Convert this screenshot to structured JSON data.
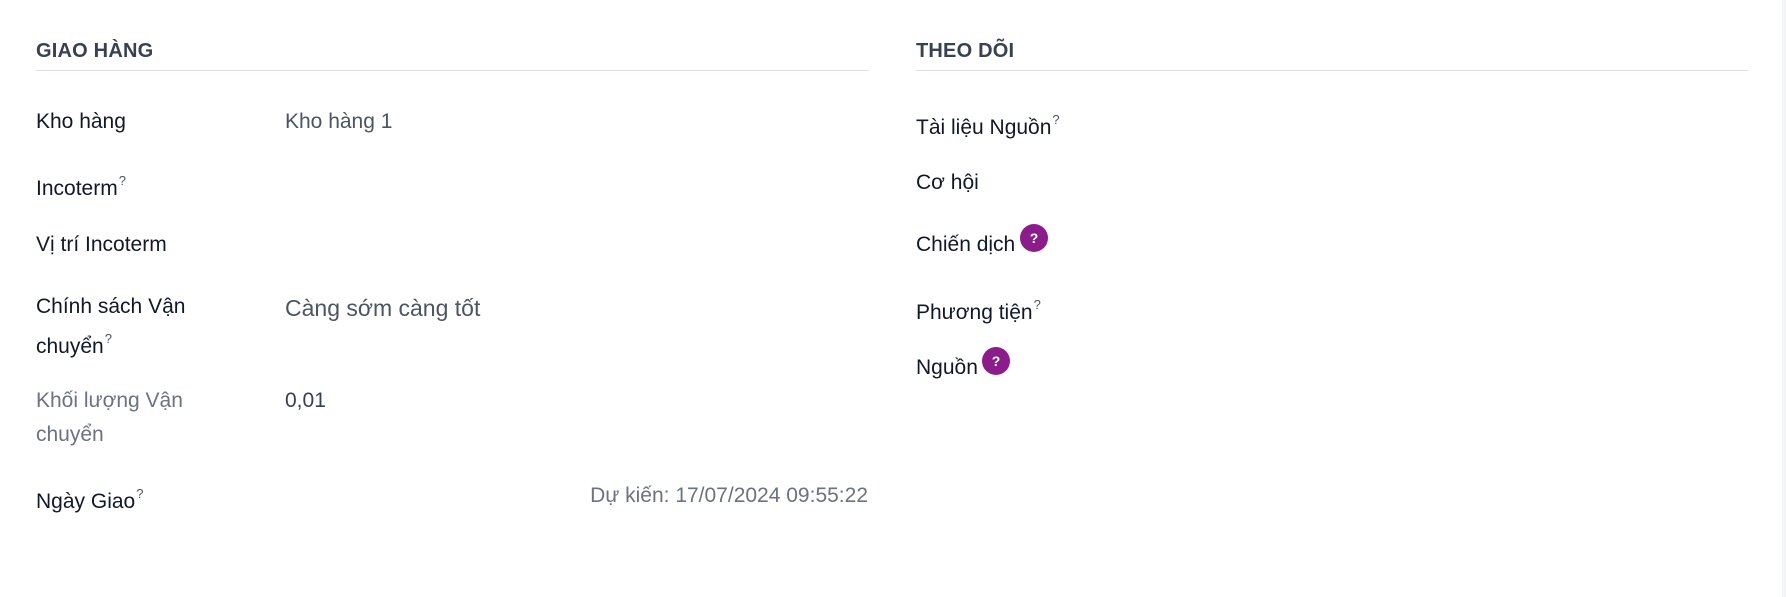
{
  "delivery": {
    "title": "GIAO HÀNG",
    "warehouse": {
      "label": "Kho hàng",
      "value": "Kho hàng 1"
    },
    "incoterm": {
      "label": "Incoterm",
      "help": "?"
    },
    "incoterm_location": {
      "label": "Vị trí Incoterm"
    },
    "shipping_policy": {
      "label_line1": "Chính sách Vận",
      "label_line2": "chuyển",
      "help": "?",
      "value": "Càng sớm càng tốt"
    },
    "shipping_weight": {
      "label_line1": "Khối lượng Vận",
      "label_line2": "chuyển",
      "value": "0,01"
    },
    "delivery_date": {
      "label": "Ngày Giao",
      "help": "?",
      "expected": "Dự kiến: 17/07/2024 09:55:22"
    }
  },
  "tracking": {
    "title": "THEO DÕI",
    "source_document": {
      "label": "Tài liệu Nguồn",
      "help": "?"
    },
    "opportunity": {
      "label": "Cơ hội"
    },
    "campaign": {
      "label": "Chiến dịch",
      "help_badge": "?"
    },
    "medium": {
      "label": "Phương tiện",
      "help": "?"
    },
    "source": {
      "label": "Nguồn",
      "help_badge": "?"
    }
  },
  "colors": {
    "badge": "#8a1d8a",
    "rule": "#dfe3e8",
    "muted": "#6b7280"
  }
}
